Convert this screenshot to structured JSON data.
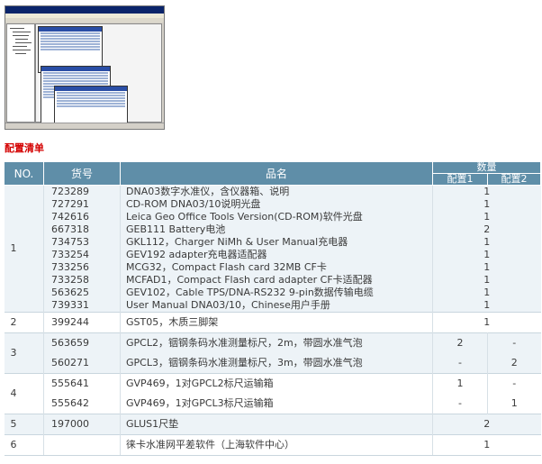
{
  "section_title": "配置清单",
  "table": {
    "headers": {
      "no": "NO.",
      "code": "货号",
      "name": "品名",
      "qty": "数量",
      "config1": "配置1",
      "config2": "配置2"
    },
    "groups": [
      {
        "no": "1",
        "items": [
          {
            "code": "723289",
            "name": "DNA03数字水准仪，含仪器箱、说明",
            "qty": "1",
            "c1": "",
            "c2": ""
          },
          {
            "code": "727291",
            "name": "CD-ROM DNA03/10说明光盘",
            "qty": "1",
            "c1": "",
            "c2": ""
          },
          {
            "code": "742616",
            "name": "Leica Geo Office Tools Version(CD-ROM)软件光盘",
            "qty": "1",
            "c1": "",
            "c2": ""
          },
          {
            "code": "667318",
            "name": "GEB111 Battery电池",
            "qty": "2",
            "c1": "",
            "c2": ""
          },
          {
            "code": "734753",
            "name": "GKL112，Charger NiMh & User Manual充电器",
            "qty": "1",
            "c1": "",
            "c2": ""
          },
          {
            "code": "733254",
            "name": "GEV192 adapter充电器适配器",
            "qty": "1",
            "c1": "",
            "c2": ""
          },
          {
            "code": "733256",
            "name": "MCG32，Compact Flash card 32MB CF卡",
            "qty": "1",
            "c1": "",
            "c2": ""
          },
          {
            "code": "733258",
            "name": "MCFAD1，Compact Flash card adapter CF卡适配器",
            "qty": "1",
            "c1": "",
            "c2": ""
          },
          {
            "code": "563625",
            "name": "GEV102，Cable TPS/DNA-RS232 9-pin数据传输电缆",
            "qty": "1",
            "c1": "",
            "c2": ""
          },
          {
            "code": "739331",
            "name": "User Manual DNA03/10，Chinese用户手册",
            "qty": "1",
            "c1": "",
            "c2": ""
          }
        ]
      },
      {
        "no": "2",
        "items": [
          {
            "code": "399244",
            "name": "GST05，木质三脚架",
            "qty": "1",
            "c1": "",
            "c2": ""
          }
        ]
      },
      {
        "no": "3",
        "items": [
          {
            "code": "563659",
            "name": "GPCL2，铟钢条码水准测量标尺，2m，带圆水准气泡",
            "qty": "",
            "c1": "2",
            "c2": "-"
          },
          {
            "code": "560271",
            "name": "GPCL3，铟钢条码水准测量标尺，3m，带圆水准气泡",
            "qty": "",
            "c1": "-",
            "c2": "2"
          }
        ]
      },
      {
        "no": "4",
        "items": [
          {
            "code": "555641",
            "name": "GVP469，1对GPCL2标尺运输箱",
            "qty": "",
            "c1": "1",
            "c2": "-"
          },
          {
            "code": "555642",
            "name": "GVP469，1对GPCL3标尺运输箱",
            "qty": "",
            "c1": "-",
            "c2": "1"
          }
        ]
      },
      {
        "no": "5",
        "items": [
          {
            "code": "197000",
            "name": "GLUS1尺垫",
            "qty": "2",
            "c1": "",
            "c2": ""
          }
        ]
      },
      {
        "no": "6",
        "items": [
          {
            "code": "",
            "name": "徕卡水准网平差软件（上海软件中心）",
            "qty": "1",
            "c1": "",
            "c2": ""
          }
        ]
      }
    ]
  }
}
